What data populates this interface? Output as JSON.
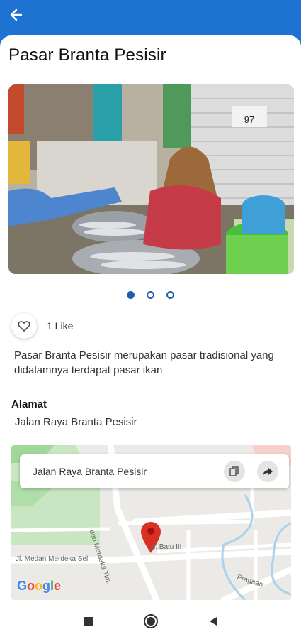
{
  "header": {
    "back_icon": "arrow-left-icon",
    "color": "#1e73d2"
  },
  "page": {
    "title": "Pasar Branta Pesisir",
    "carousel": {
      "count": 3,
      "active_index": 0,
      "photo_label": "97"
    },
    "likes": {
      "icon": "heart-outline-icon",
      "text": "1 Like"
    },
    "description": "Pasar Branta Pesisir merupakan pasar tradisional yang didalamnya terdapat pasar ikan",
    "address": {
      "label": "Alamat",
      "value": "Jalan Raya Branta Pesisir"
    }
  },
  "map": {
    "card_text": "Jalan Raya Branta Pesisir",
    "copy_icon": "copy-icon",
    "share_icon": "share-icon",
    "streets": [
      "Jl. Batu III",
      "Jl. Medan Merdeka Sel.",
      "dan Merdeka Tim.",
      "Pragaan"
    ],
    "logo": "Google",
    "pin_color": "#d93025"
  },
  "navbar": {
    "recents_icon": "square-icon",
    "home_icon": "circle-icon",
    "back_icon": "triangle-back-icon"
  }
}
